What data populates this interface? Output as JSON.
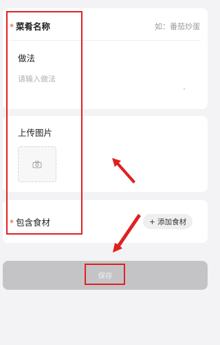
{
  "dish": {
    "name_label": "菜肴名称",
    "name_placeholder": "如：番茄炒蛋",
    "required_mark": "*"
  },
  "method": {
    "label": "做法",
    "placeholder": "请输入做法"
  },
  "upload": {
    "label": "上传图片",
    "icon": "camera-icon"
  },
  "ingredients": {
    "label": "包含食材",
    "required_mark": "*",
    "add_button": "+ 添加食材"
  },
  "save": {
    "label": "保存"
  },
  "colors": {
    "background": "#f3f3f5",
    "required": "#e8442d",
    "annotation": "#e02020",
    "save_bar": "#c4c4c6"
  }
}
